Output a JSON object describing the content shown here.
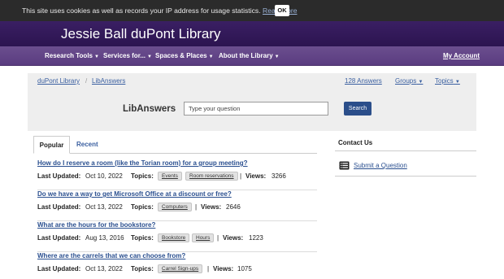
{
  "cookie": {
    "message": "This site uses cookies as well as records your IP address for usage statistics.",
    "link": "Read more",
    "ok": "OK"
  },
  "site": {
    "title": "Jessie Ball duPont Library"
  },
  "nav": {
    "items": [
      "Research Tools",
      "Services for...",
      "Spaces & Places",
      "About the Library"
    ],
    "account": "My Account"
  },
  "breadcrumb": [
    "duPont Library",
    "LibAnswers"
  ],
  "sep": "/",
  "counts": {
    "answers": "128 Answers",
    "groups": "Groups",
    "topics": "Topics"
  },
  "search": {
    "heading": "LibAnswers",
    "placeholder": "Type your question",
    "button": "Search"
  },
  "tabs": {
    "popular": "Popular",
    "recent": "Recent"
  },
  "labels": {
    "last_updated": "Last Updated:",
    "topics": "Topics:",
    "views": "Views:",
    "bar": "|"
  },
  "faqs": [
    {
      "question": "How do I reserve a room (like the Torian room) for a group meeting?",
      "date": "Oct 10, 2022",
      "topics": [
        "Events",
        "Room reservations"
      ],
      "views": "3266"
    },
    {
      "question": "Do we have a way to get Microsoft Office at a discount or free?",
      "date": "Oct 13, 2022",
      "topics": [
        "Computers"
      ],
      "views": "2646"
    },
    {
      "question": "What are the hours for the bookstore?",
      "date": "Aug 13, 2016",
      "topics": [
        "Bookstore",
        "Hours"
      ],
      "views": "1223"
    },
    {
      "question": "Where are the carrels that we can choose from?",
      "date": "Oct 13, 2022",
      "topics": [
        "Carrel Sign-ups"
      ],
      "views": "1075"
    }
  ],
  "contact": {
    "heading": "Contact Us",
    "link": "Submit a Question",
    "icon": "form-icon"
  },
  "colors": {
    "banner": "#2c1450",
    "nav": "#5a3c80",
    "link": "#2a4f8f",
    "search_button": "#2b4e8a"
  }
}
